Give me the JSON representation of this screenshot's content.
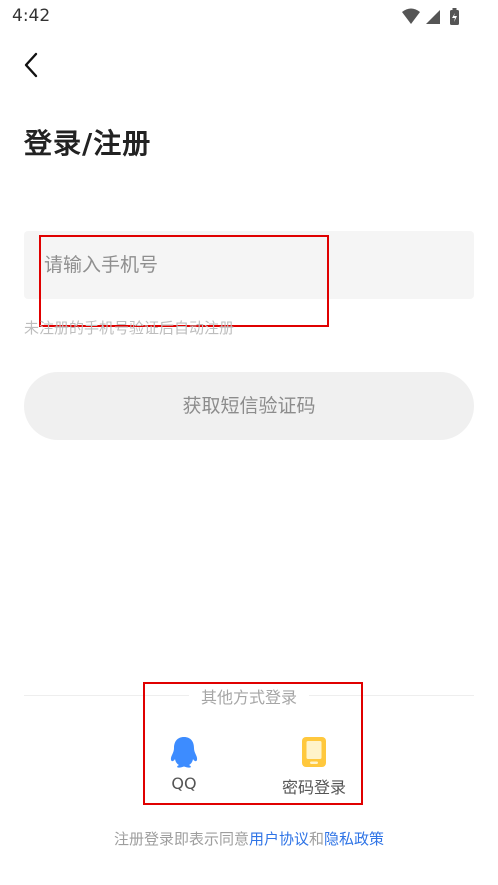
{
  "status_bar": {
    "time": "4:42"
  },
  "header": {
    "title": "登录/注册"
  },
  "form": {
    "phone_placeholder": "请输入手机号",
    "hint": "未注册的手机号验证后自动注册",
    "sms_button_label": "获取短信验证码"
  },
  "alt_login": {
    "divider_label": "其他方式登录",
    "options": [
      {
        "label": "QQ",
        "icon": "qq-penguin-icon",
        "color": "#3d8cff"
      },
      {
        "label": "密码登录",
        "icon": "phone-icon",
        "color": "#ffc83d"
      }
    ]
  },
  "agreement": {
    "prefix": "注册登录即表示同意",
    "user_agreement": "用户协议",
    "conjunction": "和",
    "privacy_policy": "隐私政策",
    "link_color": "#2f74e6"
  }
}
